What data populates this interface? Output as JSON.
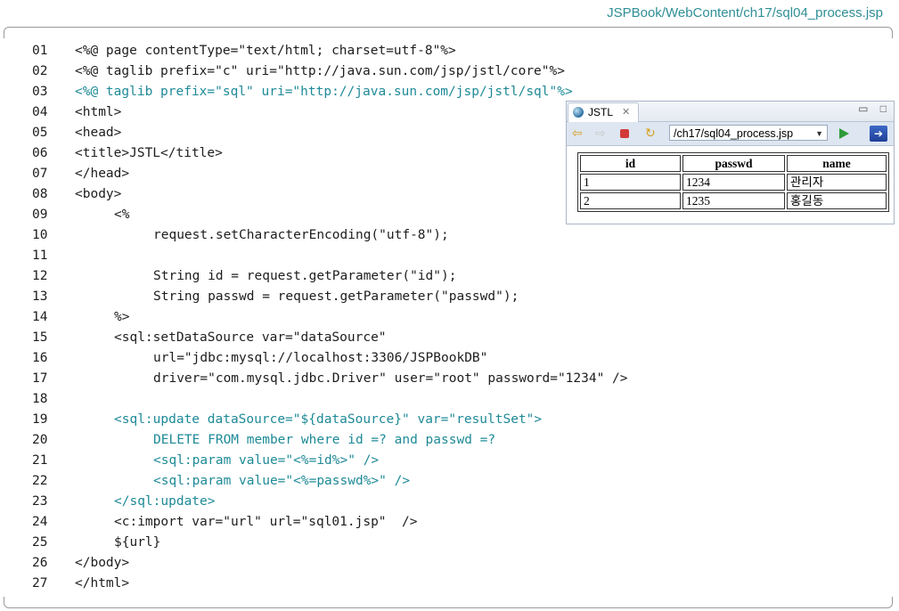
{
  "file_path": "JSPBook/WebContent/ch17/sql04_process.jsp",
  "code_lines": [
    {
      "num": "01",
      "text": "<%@ page contentType=\"text/html; charset=utf-8\"%>",
      "indent": 0,
      "teal": false
    },
    {
      "num": "02",
      "text": "<%@ taglib prefix=\"c\" uri=\"http://java.sun.com/jsp/jstl/core\"%>",
      "indent": 0,
      "teal": false
    },
    {
      "num": "03",
      "text": "<%@ taglib prefix=\"sql\" uri=\"http://java.sun.com/jsp/jstl/sql\"%>",
      "indent": 0,
      "teal": true
    },
    {
      "num": "04",
      "text": "<html>",
      "indent": 0,
      "teal": false
    },
    {
      "num": "05",
      "text": "<head>",
      "indent": 0,
      "teal": false
    },
    {
      "num": "06",
      "text": "<title>JSTL</title>",
      "indent": 0,
      "teal": false
    },
    {
      "num": "07",
      "text": "</head>",
      "indent": 0,
      "teal": false
    },
    {
      "num": "08",
      "text": "<body>",
      "indent": 0,
      "teal": false
    },
    {
      "num": "09",
      "text": "<%",
      "indent": 1,
      "teal": false
    },
    {
      "num": "10",
      "text": "request.setCharacterEncoding(\"utf-8\");",
      "indent": 2,
      "teal": false
    },
    {
      "num": "11",
      "text": "",
      "indent": 0,
      "teal": false
    },
    {
      "num": "12",
      "text": "String id = request.getParameter(\"id\");",
      "indent": 2,
      "teal": false
    },
    {
      "num": "13",
      "text": "String passwd = request.getParameter(\"passwd\");",
      "indent": 2,
      "teal": false
    },
    {
      "num": "14",
      "text": "%>",
      "indent": 1,
      "teal": false
    },
    {
      "num": "15",
      "text": "<sql:setDataSource var=\"dataSource\"",
      "indent": 1,
      "teal": false
    },
    {
      "num": "16",
      "text": "url=\"jdbc:mysql://localhost:3306/JSPBookDB\"",
      "indent": 2,
      "teal": false
    },
    {
      "num": "17",
      "text": "driver=\"com.mysql.jdbc.Driver\" user=\"root\" password=\"1234\" />",
      "indent": 2,
      "teal": false
    },
    {
      "num": "18",
      "text": "",
      "indent": 0,
      "teal": false
    },
    {
      "num": "19",
      "text": "<sql:update dataSource=\"${dataSource}\" var=\"resultSet\">",
      "indent": 1,
      "teal": true
    },
    {
      "num": "20",
      "text": "DELETE FROM member where id =? and passwd =?",
      "indent": 2,
      "teal": true
    },
    {
      "num": "21",
      "text": "<sql:param value=\"<%=id%>\" />",
      "indent": 2,
      "teal": true
    },
    {
      "num": "22",
      "text": "<sql:param value=\"<%=passwd%>\" />",
      "indent": 2,
      "teal": true
    },
    {
      "num": "23",
      "text": "</sql:update>",
      "indent": 1,
      "teal": true
    },
    {
      "num": "24",
      "text": "<c:import var=\"url\" url=\"sql01.jsp\"  />",
      "indent": 1,
      "teal": false
    },
    {
      "num": "25",
      "text": "${url}",
      "indent": 1,
      "teal": false
    },
    {
      "num": "26",
      "text": "</body>",
      "indent": 0,
      "teal": false
    },
    {
      "num": "27",
      "text": "</html>",
      "indent": 0,
      "teal": false
    }
  ],
  "browser": {
    "tab_label": "JSTL",
    "tab_close": "✕",
    "minimize": "▭",
    "maximize": "□",
    "url": "/ch17/sql04_process.jsp",
    "table": {
      "headers": [
        "id",
        "passwd",
        "name"
      ],
      "rows": [
        [
          "1",
          "1234",
          "관리자"
        ],
        [
          "2",
          "1235",
          "홍길동"
        ]
      ]
    }
  }
}
